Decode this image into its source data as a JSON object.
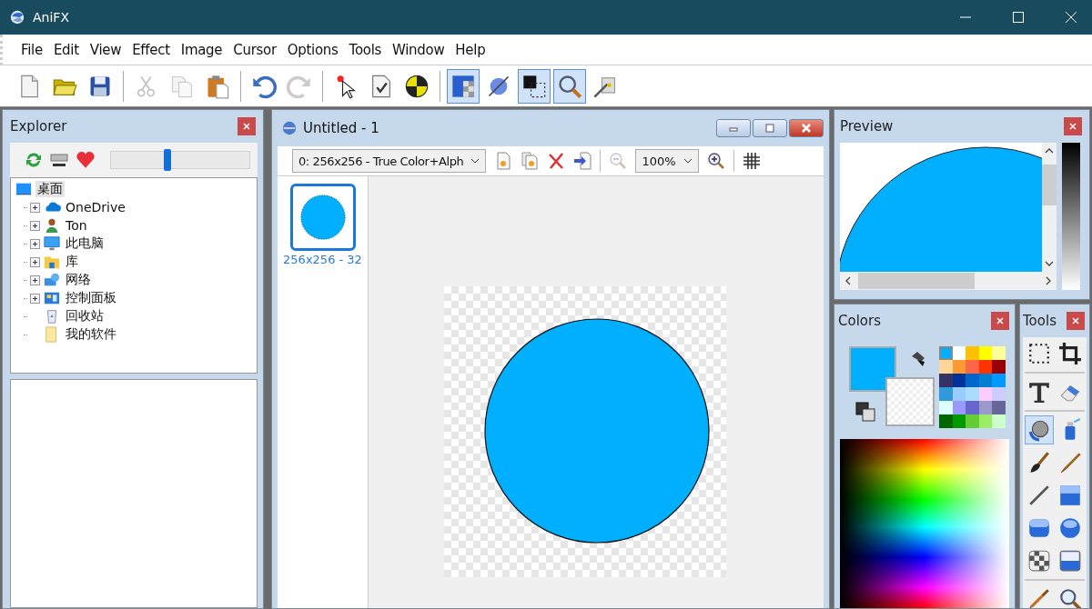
{
  "window": {
    "title": "AniFX"
  },
  "menu": [
    "File",
    "Edit",
    "View",
    "Effect",
    "Image",
    "Cursor",
    "Options",
    "Tools",
    "Window",
    "Help"
  ],
  "toolbar": [
    {
      "disabled": false,
      "selected": false
    },
    {
      "disabled": false,
      "selected": false
    },
    {
      "disabled": false,
      "selected": false
    },
    {
      "disabled": true,
      "selected": false
    },
    {
      "disabled": true,
      "selected": false
    },
    {
      "disabled": false,
      "selected": false
    },
    {
      "disabled": false,
      "selected": false
    },
    {
      "disabled": true,
      "selected": false
    },
    {
      "disabled": false,
      "selected": false
    },
    {
      "disabled": false,
      "selected": false
    },
    {
      "disabled": false,
      "selected": false
    },
    {
      "disabled": false,
      "selected": true
    },
    {
      "disabled": false,
      "selected": false
    },
    {
      "disabled": false,
      "selected": true
    },
    {
      "disabled": false,
      "selected": true
    },
    {
      "disabled": false,
      "selected": false
    }
  ],
  "explorer": {
    "title": "Explorer",
    "slider": {
      "level": 0.41
    },
    "tree": [
      {
        "label": "桌面",
        "selected": true,
        "expandable": false,
        "children": [
          {
            "label": "OneDrive",
            "selected": false,
            "expandable": true
          },
          {
            "label": "Ton",
            "selected": false,
            "expandable": true
          },
          {
            "label": "此电脑",
            "selected": false,
            "expandable": true
          },
          {
            "label": "库",
            "selected": false,
            "expandable": true
          },
          {
            "label": "网络",
            "selected": false,
            "expandable": true
          },
          {
            "label": "控制面板",
            "selected": false,
            "expandable": true
          },
          {
            "label": "回收站",
            "selected": false,
            "expandable": false
          },
          {
            "label": "我的软件",
            "selected": false,
            "expandable": false
          }
        ]
      }
    ]
  },
  "document": {
    "title": "Untitled - 1",
    "format": "0: 256x256 - True Color+Alph",
    "zoom": "100%",
    "zoom_out": {
      "disabled": true
    },
    "frames": [
      {
        "label": "256x256 - 32",
        "selected": true
      }
    ]
  },
  "preview": {
    "title": "Preview"
  },
  "colors": {
    "title": "Colors",
    "palette": [
      {
        "color": "#00b0ff",
        "selected": true
      },
      {
        "color": "#ffffff",
        "selected": false
      },
      {
        "color": "#ffc000",
        "selected": false
      },
      {
        "color": "#ffff00",
        "selected": false
      },
      {
        "color": "#ffff99",
        "selected": false
      },
      {
        "color": "#ffd699",
        "selected": false
      },
      {
        "color": "#ff9933",
        "selected": false
      },
      {
        "color": "#ff6644",
        "selected": false
      },
      {
        "color": "#ff3300",
        "selected": false
      },
      {
        "color": "#990000",
        "selected": false
      },
      {
        "color": "#333366",
        "selected": false
      },
      {
        "color": "#003399",
        "selected": false
      },
      {
        "color": "#0066cc",
        "selected": false
      },
      {
        "color": "#0080d0",
        "selected": false
      },
      {
        "color": "#0099ff",
        "selected": false
      },
      {
        "color": "#3399dd",
        "selected": false
      },
      {
        "color": "#99ccff",
        "selected": false
      },
      {
        "color": "#aaddff",
        "selected": false
      },
      {
        "color": "#ffccff",
        "selected": false
      },
      {
        "color": "#ccccff",
        "selected": false
      },
      {
        "color": "#ddffff",
        "selected": false
      },
      {
        "color": "#9999ff",
        "selected": false
      },
      {
        "color": "#6666cc",
        "selected": false
      },
      {
        "color": "#9999cc",
        "selected": false
      },
      {
        "color": "#666699",
        "selected": false
      },
      {
        "color": "#006600",
        "selected": false
      },
      {
        "color": "#009900",
        "selected": false
      },
      {
        "color": "#66cc33",
        "selected": false
      },
      {
        "color": "#99ee66",
        "selected": false
      },
      {
        "color": "#ccffcc",
        "selected": false
      }
    ]
  },
  "tools": {
    "title": "Tools",
    "items": [
      {
        "selected": false
      },
      {
        "selected": false
      },
      {
        "selected": false
      },
      {
        "selected": false
      },
      {
        "selected": true
      },
      {
        "selected": false
      },
      {
        "selected": false
      },
      {
        "selected": false
      },
      {
        "selected": false
      },
      {
        "selected": false
      },
      {
        "selected": false
      },
      {
        "selected": false
      },
      {
        "selected": false
      },
      {
        "selected": false
      },
      {
        "selected": false
      },
      {
        "selected": false
      }
    ]
  }
}
